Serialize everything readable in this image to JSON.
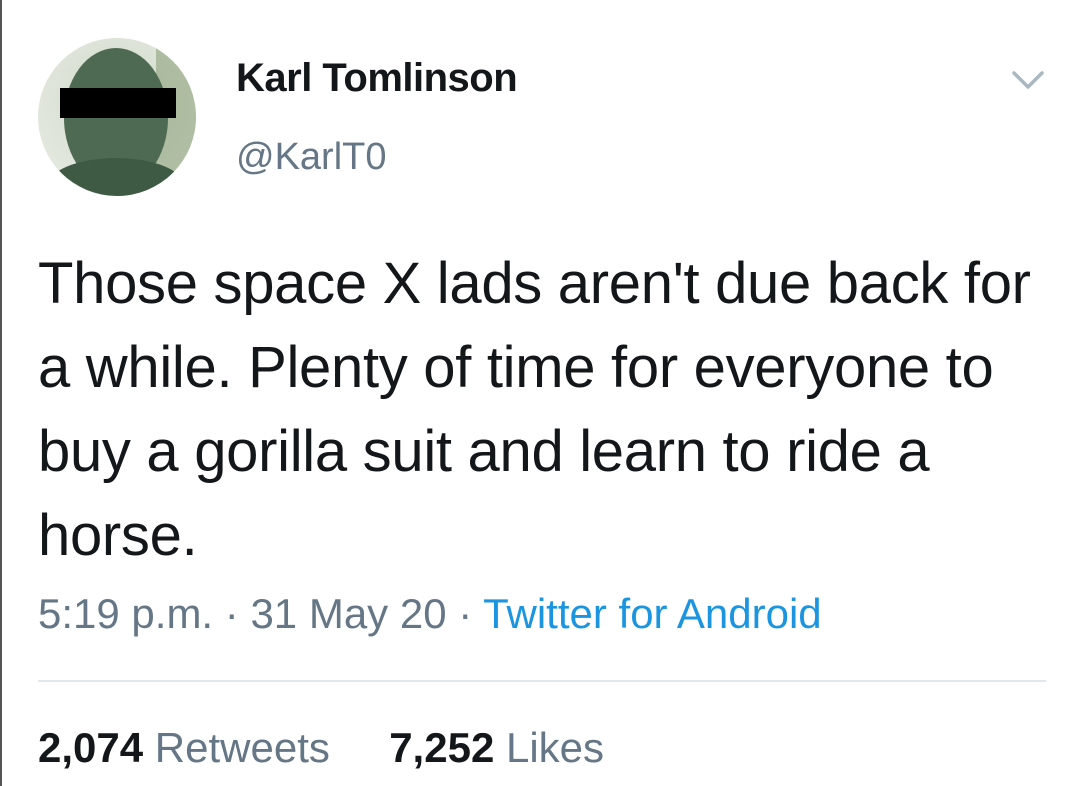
{
  "user": {
    "name": "Karl Tomlinson",
    "handle": "@KarlT0"
  },
  "tweet": {
    "text": "Those space X lads aren't due back for a while. Plenty of time for everyone to buy a gorilla suit and learn to ride a horse.",
    "time": "5:19 p.m.",
    "separator": "·",
    "date": "31 May 20",
    "source": "Twitter for Android"
  },
  "stats": {
    "retweets_count": "2,074",
    "retweets_label": "Retweets",
    "likes_count": "7,252",
    "likes_label": "Likes"
  },
  "icons": {
    "menu": "chevron-down-icon"
  },
  "colors": {
    "text": "#14171a",
    "muted": "#657786",
    "link": "#1b95e0",
    "divider": "#e1e8ed"
  }
}
